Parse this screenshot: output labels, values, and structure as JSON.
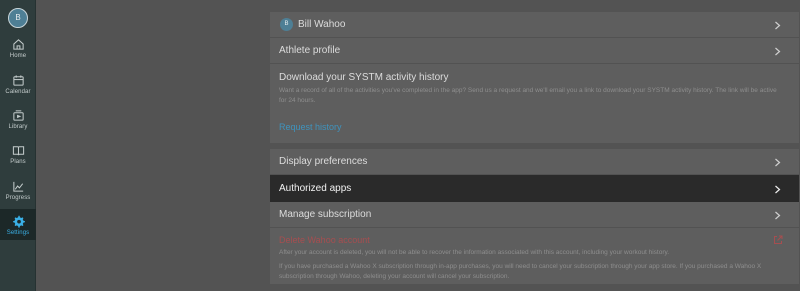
{
  "sidebar": {
    "avatar_initial": "B",
    "items": [
      {
        "label": "Home",
        "icon": "home-icon"
      },
      {
        "label": "Calendar",
        "icon": "calendar-icon"
      },
      {
        "label": "Library",
        "icon": "library-icon"
      },
      {
        "label": "Plans",
        "icon": "plans-icon"
      },
      {
        "label": "Progress",
        "icon": "progress-icon"
      },
      {
        "label": "Settings",
        "icon": "gear-icon",
        "active": true
      }
    ]
  },
  "account": {
    "user_initial": "B",
    "user_name": "Bill Wahoo",
    "athlete_profile": "Athlete profile",
    "download_title": "Download your SYSTM activity history",
    "download_desc": "Want a record of all of the activities you've completed in the app? Send us a request and we'll email you a link to download your SYSTM activity history. The link will be active for 24 hours.",
    "request_link": "Request history"
  },
  "preferences": {
    "display": "Display preferences",
    "authorized": "Authorized apps",
    "subscription": "Manage subscription",
    "delete_title": "Delete Wahoo account",
    "delete_desc_1": "After your account is deleted, you will not be able to recover the information associated with this account, including your workout history.",
    "delete_desc_2": "If you have purchased a Wahoo X subscription through in-app purchases, you will need to cancel your subscription through your app store. If you purchased a Wahoo X subscription through Wahoo, deleting your account will cancel your subscription."
  },
  "colors": {
    "accent": "#3ab0e6",
    "link": "#3f93bd",
    "danger": "#a64e50",
    "sidebar_bg": "#2f3d3d"
  }
}
